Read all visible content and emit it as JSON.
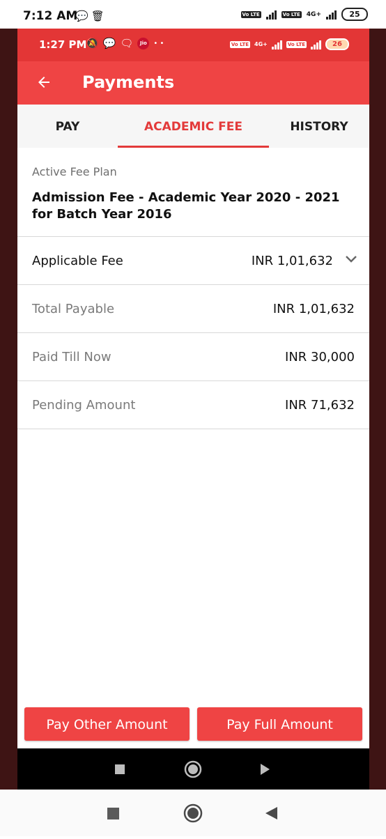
{
  "outer_status": {
    "time": "7:12 AM",
    "battery": "25",
    "network_label": "4G+",
    "lte_badge": "Vo LTE",
    "icons": [
      "chat-bubble-icon",
      "trash-icon"
    ]
  },
  "inner_status": {
    "time": "1:27 PM",
    "jio_label": "Jio",
    "dots": "• •",
    "battery": "26",
    "network_label": "4G+",
    "lte_badge": "Vo LTE",
    "icons": [
      "bell-off-icon",
      "message-icon",
      "chat-bubble-icon"
    ]
  },
  "appbar": {
    "title": "Payments",
    "back_icon": "arrow-left-icon"
  },
  "tabs": [
    {
      "label": "PAY",
      "active": false
    },
    {
      "label": "ACADEMIC FEE",
      "active": true
    },
    {
      "label": "HISTORY",
      "active": false
    }
  ],
  "plan": {
    "label": "Active Fee Plan",
    "name": "Admission Fee - Academic Year 2020 - 2021 for Batch Year 2016"
  },
  "rows": [
    {
      "label": "Applicable Fee",
      "value": "INR 1,01,632"
    },
    {
      "label": "Total Payable",
      "value": "INR 1,01,632"
    },
    {
      "label": "Paid Till Now",
      "value": "INR 30,000"
    },
    {
      "label": "Pending Amount",
      "value": "INR 71,632"
    }
  ],
  "buttons": {
    "pay_other": "Pay Other Amount",
    "pay_full": "Pay Full Amount"
  },
  "colors": {
    "primary": "#ef4444",
    "status": "#e33636",
    "accent_text": "#e33a3a",
    "frame": "#3e1414"
  }
}
